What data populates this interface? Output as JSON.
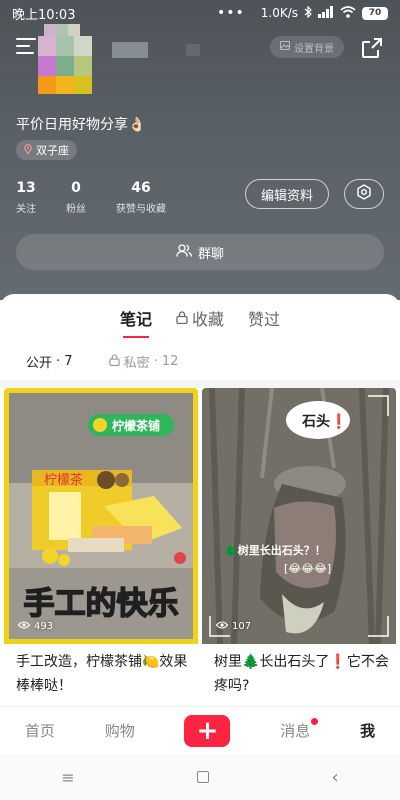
{
  "status_bar": {
    "time": "晚上10:03",
    "dots": "•••",
    "speed": "1.0K/s",
    "battery": "70"
  },
  "profile": {
    "set_background": "设置背景",
    "bio": "平价日用好物分享👌🏻",
    "zodiac": "双子座",
    "stats": [
      {
        "value": "13",
        "label": "关注"
      },
      {
        "value": "0",
        "label": "粉丝"
      },
      {
        "value": "46",
        "label": "获赞与收藏"
      }
    ],
    "edit_profile": "编辑资料",
    "group_chat": "群聊"
  },
  "tabs": [
    "笔记",
    "收藏",
    "赞过"
  ],
  "subtabs": [
    {
      "label": "公开",
      "count": "· 7"
    },
    {
      "label": "私密",
      "count": "· 12"
    }
  ],
  "notes": [
    {
      "title": "手工改造，柠檬茶铺🍋效果棒棒哒！",
      "views": "493",
      "img_tag": "柠檬茶铺",
      "img_caption": "手工的快乐"
    },
    {
      "title": "树里🌲长出石头了❗️它不会疼吗?",
      "views": "107",
      "img_tag": "石头❗",
      "img_caption": "🌲树里长出石头？！",
      "img_emoji": "[😂😂😂]"
    }
  ],
  "bottom_nav": {
    "home": "首页",
    "shop": "购物",
    "plus": "+",
    "messages": "消息",
    "me": "我"
  },
  "system_nav": {
    "menu": "≡",
    "back": "‹"
  },
  "colors": {
    "accent": "#ff2442",
    "header_bg": "#5a6166"
  }
}
